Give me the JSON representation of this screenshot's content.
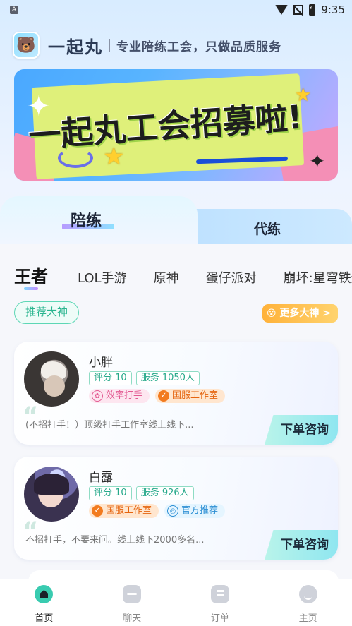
{
  "status_bar": {
    "time": "9:35",
    "left_icon": "A"
  },
  "header": {
    "app_name": "一起丸",
    "slogan": "专业陪练工会，只做品质服务"
  },
  "banner": {
    "text": "一起丸工会招募啦!"
  },
  "main_tabs": [
    {
      "label": "陪练",
      "active": true
    },
    {
      "label": "代练",
      "active": false
    }
  ],
  "game_tabs": [
    {
      "label": "王者",
      "active": true
    },
    {
      "label": "LOL手游"
    },
    {
      "label": "原神"
    },
    {
      "label": "蛋仔派对"
    },
    {
      "label": "崩坏:星穹铁道"
    }
  ],
  "recommend_label": "推荐大神",
  "more_label": "更多大神 >",
  "cards": [
    {
      "name": "小胖",
      "rating": "评分 10",
      "service": "服务 1050人",
      "badges": [
        {
          "label": "效率打手",
          "style": "pink"
        },
        {
          "label": "国服工作室",
          "style": "orange"
        }
      ],
      "description": "(不招打手！）顶级打手工作室线上线下...",
      "button": "下单咨询"
    },
    {
      "name": "白露",
      "rating": "评分 10",
      "service": "服务 926人",
      "badges": [
        {
          "label": "国服工作室",
          "style": "orange"
        },
        {
          "label": "官方推荐",
          "style": "teal"
        }
      ],
      "description": "不招打手，不要来问。线上线下2000多名...",
      "button": "下单咨询"
    }
  ],
  "bottom_nav": [
    {
      "label": "首页",
      "icon": "home-icon",
      "active": true
    },
    {
      "label": "聊天",
      "icon": "chat-icon"
    },
    {
      "label": "订单",
      "icon": "order-icon"
    },
    {
      "label": "主页",
      "icon": "profile-icon"
    }
  ],
  "colors": {
    "accent": "#39cbb0",
    "orange": "#ffb23a",
    "teal_tag": "#27a98a"
  }
}
